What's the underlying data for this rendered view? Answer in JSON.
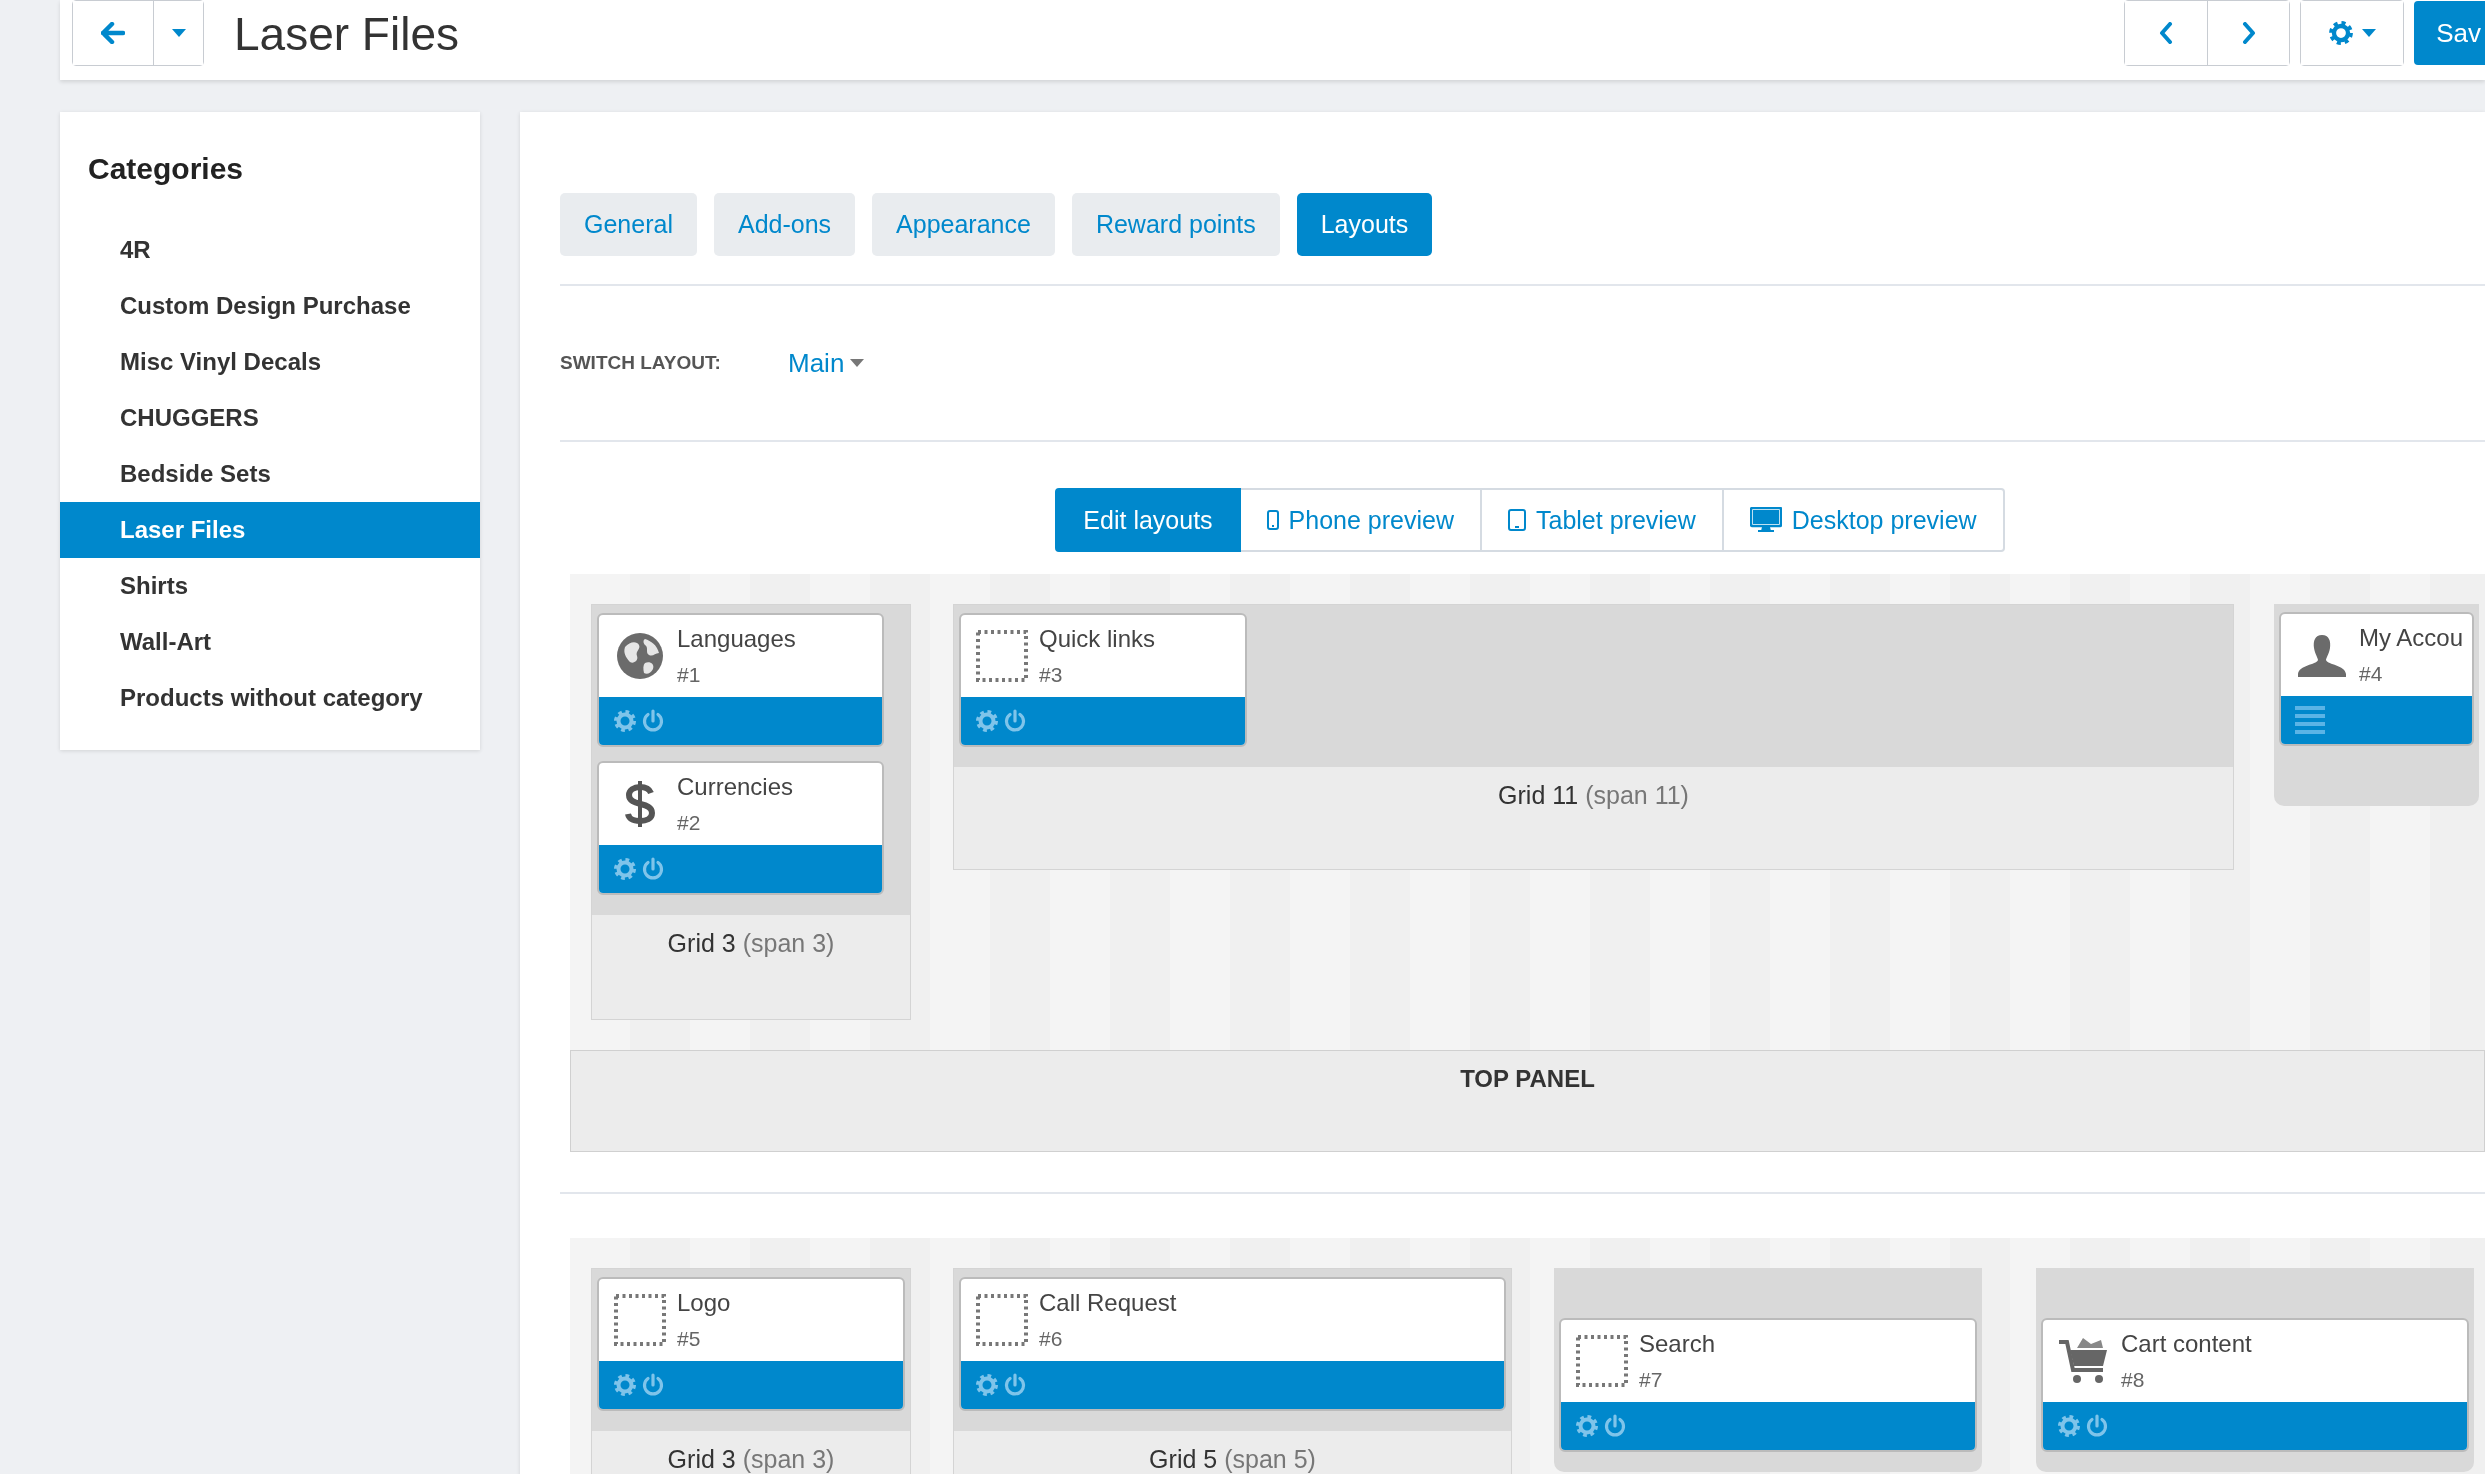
{
  "toolbar": {
    "title": "Laser Files",
    "save_label": "Sav"
  },
  "sidebar": {
    "title": "Categories",
    "items": [
      {
        "label": "4R",
        "selected": false
      },
      {
        "label": "Custom Design Purchase",
        "selected": false
      },
      {
        "label": "Misc Vinyl Decals",
        "selected": false
      },
      {
        "label": "CHUGGERS",
        "selected": false
      },
      {
        "label": "Bedside Sets",
        "selected": false
      },
      {
        "label": "Laser Files",
        "selected": true
      },
      {
        "label": "Shirts",
        "selected": false
      },
      {
        "label": "Wall-Art",
        "selected": false
      },
      {
        "label": "Products without category",
        "selected": false
      }
    ]
  },
  "tabs": [
    {
      "label": "General",
      "selected": false
    },
    {
      "label": "Add-ons",
      "selected": false
    },
    {
      "label": "Appearance",
      "selected": false
    },
    {
      "label": "Reward points",
      "selected": false
    },
    {
      "label": "Layouts",
      "selected": true
    }
  ],
  "switch_layout": {
    "label": "SWITCH LAYOUT:",
    "value": "Main"
  },
  "view_modes": [
    {
      "label": "Edit layouts",
      "selected": true
    },
    {
      "label": "Phone preview",
      "selected": false
    },
    {
      "label": "Tablet preview",
      "selected": false
    },
    {
      "label": "Desktop preview",
      "selected": false
    }
  ],
  "sections": [
    {
      "label": "TOP PANEL",
      "grids": [
        {
          "title": "Grid 3",
          "span": "(span 3)",
          "blocks": [
            {
              "name": "Languages",
              "number": "#1",
              "kind": "standard"
            },
            {
              "name": "Currencies",
              "number": "#2",
              "kind": "standard"
            }
          ]
        },
        {
          "title": "Grid 11",
          "span": "(span 11)",
          "blocks": [
            {
              "name": "Quick links",
              "number": "#3",
              "kind": "standard"
            }
          ]
        },
        {
          "blocks": [
            {
              "name": "My Accou",
              "number": "#4",
              "kind": "menu"
            }
          ]
        }
      ]
    },
    {
      "grids": [
        {
          "title": "Grid 3",
          "span": "(span 3)",
          "blocks": [
            {
              "name": "Logo",
              "number": "#5",
              "kind": "standard"
            }
          ]
        },
        {
          "title": "Grid 5",
          "span": "(span 5)",
          "blocks": [
            {
              "name": "Call Request",
              "number": "#6",
              "kind": "standard"
            }
          ]
        },
        {
          "blocks": [
            {
              "name": "Search",
              "number": "#7",
              "kind": "standard"
            }
          ]
        },
        {
          "blocks": [
            {
              "name": "Cart content",
              "number": "#8",
              "kind": "standard"
            }
          ]
        }
      ]
    }
  ]
}
